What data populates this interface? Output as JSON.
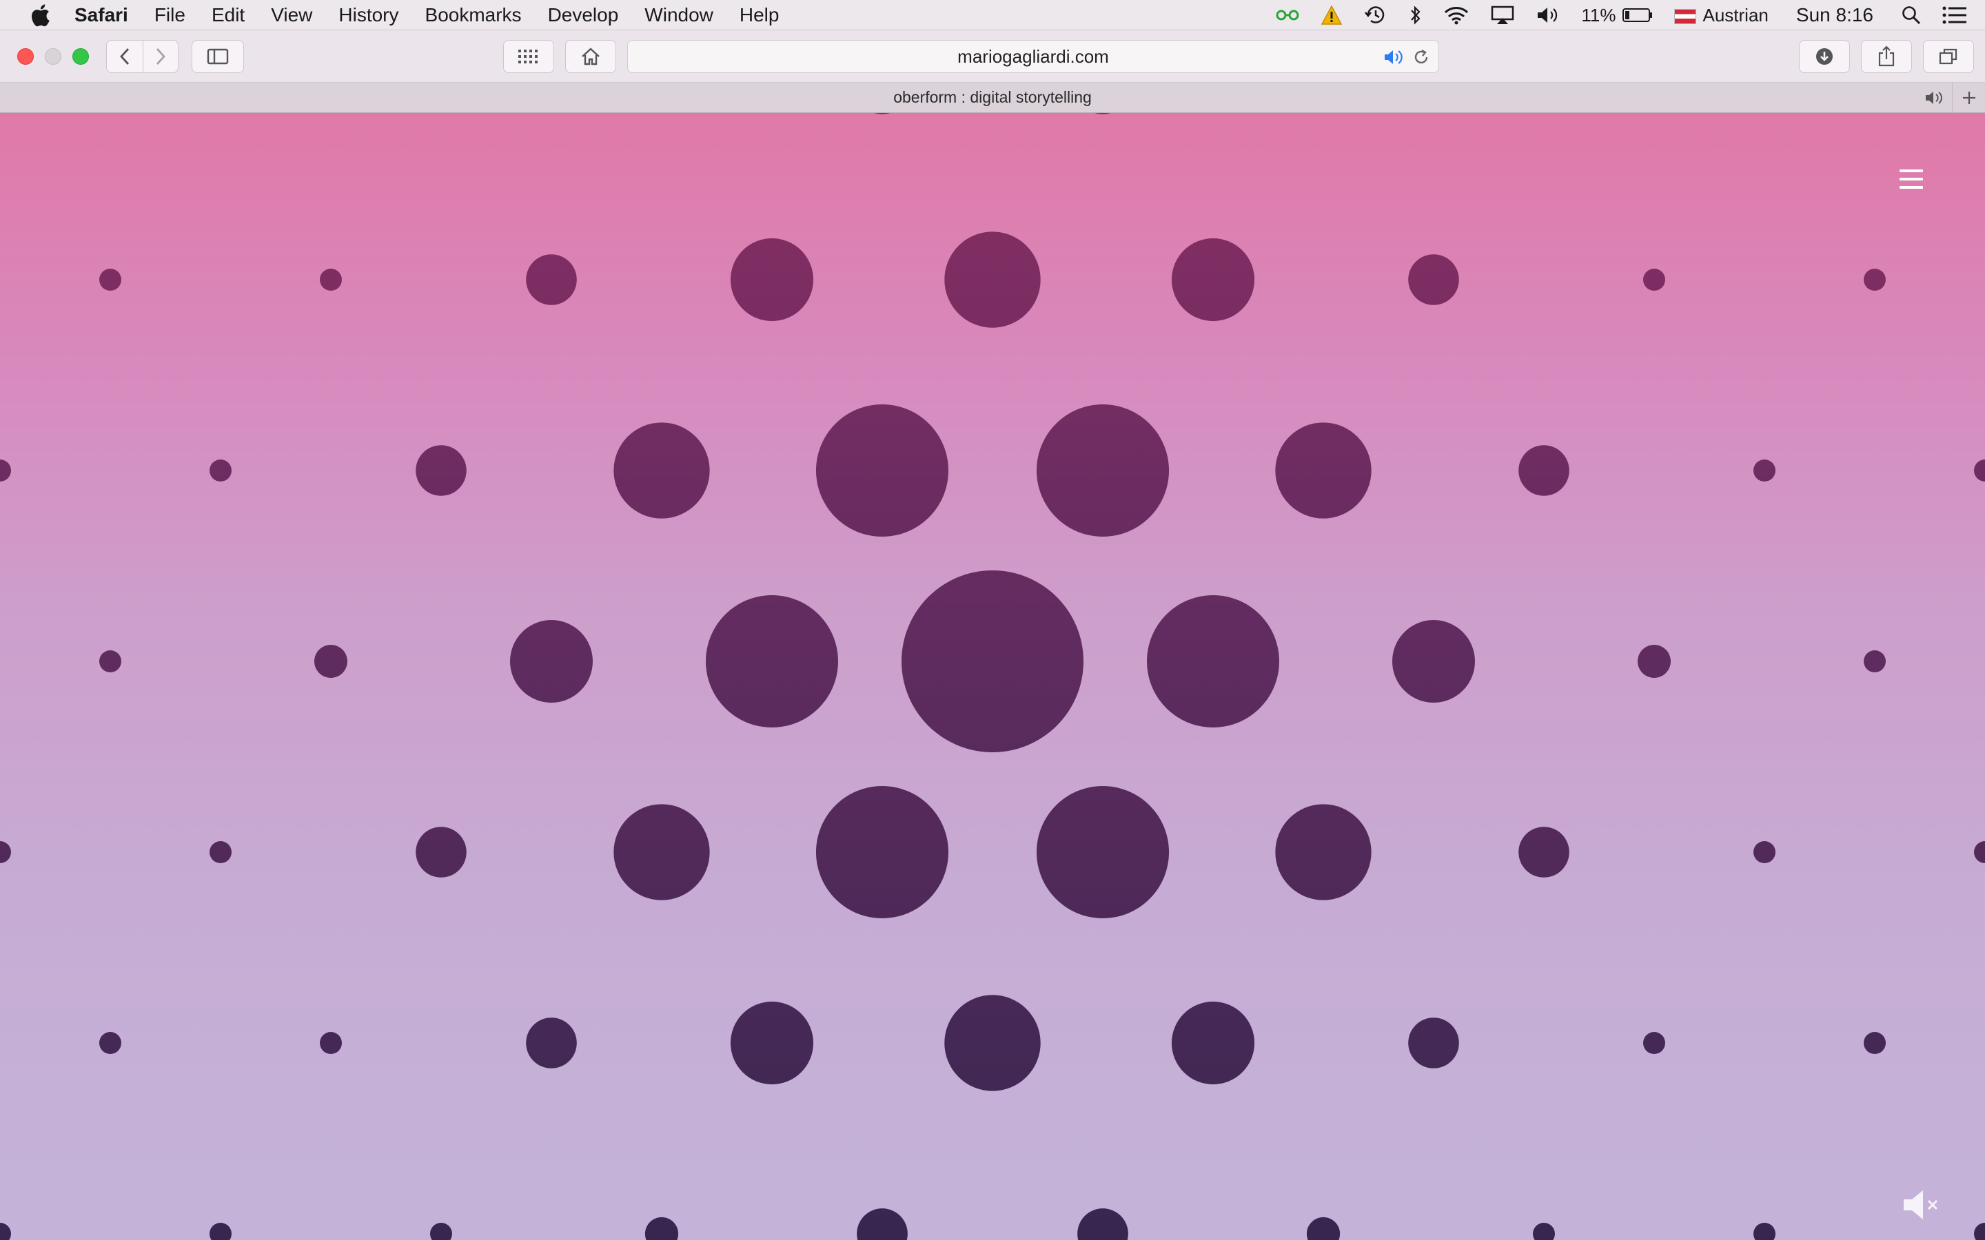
{
  "menubar": {
    "app_name": "Safari",
    "items": [
      "File",
      "Edit",
      "View",
      "History",
      "Bookmarks",
      "Develop",
      "Window",
      "Help"
    ],
    "battery_percent": "11%",
    "input_source": "Austrian",
    "clock": "Sun 8:16",
    "icons": [
      "apple-logo",
      "green-extension-icon",
      "warning-icon",
      "time-machine-icon",
      "bluetooth-icon",
      "wifi-icon",
      "airplay-icon",
      "volume-icon",
      "battery-icon",
      "spotlight-icon",
      "notification-center-icon"
    ]
  },
  "toolbar": {
    "url": "mariogagliardi.com",
    "icons": [
      "back-icon",
      "forward-icon",
      "sidebar-icon",
      "top-sites-grid-icon",
      "home-icon",
      "audio-icon",
      "reload-icon",
      "downloads-icon",
      "share-icon",
      "tabs-overview-icon"
    ]
  },
  "tab": {
    "title": "oberform : digital storytelling",
    "icons": [
      "tab-audio-icon",
      "new-tab-icon"
    ]
  },
  "page": {
    "icons": [
      "hamburger-menu-icon",
      "mute-icon"
    ],
    "colors": {
      "gradient_top": "#e079a8",
      "gradient_bottom": "#c4b3d9",
      "dot_top": "#8a2e63",
      "dot_bottom": "#372650",
      "menu_icon": "#ffffff"
    }
  }
}
